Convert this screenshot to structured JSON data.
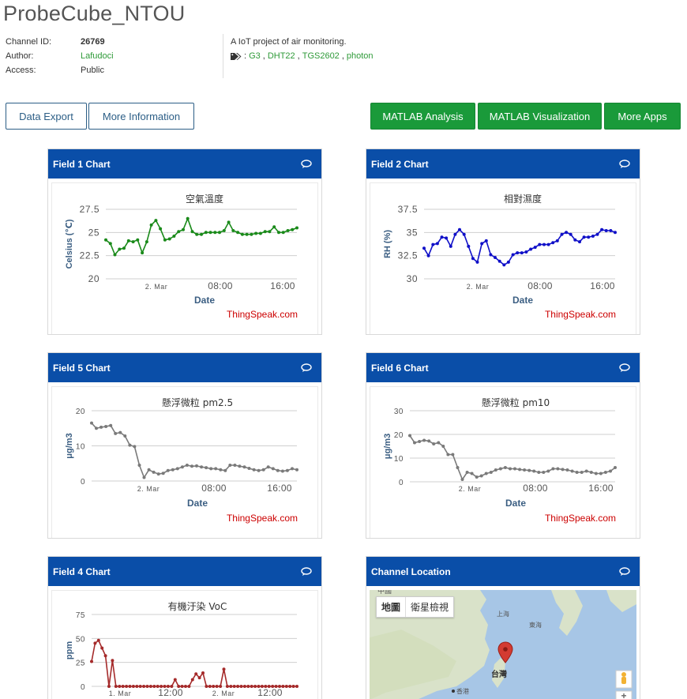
{
  "page": {
    "title": "ProbeCube_NTOU"
  },
  "channel": {
    "id_label": "Channel ID:",
    "id_value": "26769",
    "author_label": "Author:",
    "author_value": "Lafudoci",
    "access_label": "Access:",
    "access_value": "Public",
    "description": "A IoT project of air monitoring.",
    "tags": [
      "G3",
      "DHT22",
      "TGS2602",
      "photon"
    ]
  },
  "buttons": {
    "data_export": "Data Export",
    "more_information": "More Information",
    "matlab_analysis": "MATLAB Analysis",
    "matlab_visualization": "MATLAB Visualization",
    "more_apps": "More Apps"
  },
  "colors": {
    "header_blue": "#0a4ea8",
    "green_button": "#1a9a3a",
    "field1": "#1a8a1a",
    "field2": "#1010c8",
    "field5": "#7a7a7a",
    "field6": "#7a7a7a",
    "field4": "#a52a2a",
    "credit": "#cc0000"
  },
  "cards": {
    "field1": {
      "title": "Field 1 Chart",
      "credit": "ThingSpeak.com"
    },
    "field2": {
      "title": "Field 2 Chart",
      "credit": "ThingSpeak.com"
    },
    "field5": {
      "title": "Field 5 Chart",
      "credit": "ThingSpeak.com"
    },
    "field6": {
      "title": "Field 6 Chart",
      "credit": "ThingSpeak.com"
    },
    "field4": {
      "title": "Field 4 Chart"
    },
    "location": {
      "title": "Channel Location"
    }
  },
  "map": {
    "map_button": "地圖",
    "satellite_button": "衛星檢視",
    "labels": [
      "中國",
      "上海",
      "東海",
      "台灣",
      "香港"
    ],
    "marker": "location-pin-icon",
    "pegman": "pegman-icon",
    "zoom_in": "+"
  },
  "chart_data": [
    {
      "type": "line",
      "title": "空氣溫度",
      "xlabel": "Date",
      "ylabel": "Celsius (℃)",
      "ylim": [
        20,
        27.5
      ],
      "yticks": [
        "20",
        "22.5",
        "25",
        "27.5"
      ],
      "xticks": [
        "2. Mar",
        "08:00",
        "16:00"
      ],
      "series": [
        {
          "values": [
            24.2,
            23.8,
            22.6,
            23.2,
            23.3,
            24.1,
            24.0,
            24.2,
            22.8,
            24.0,
            25.8,
            26.3,
            25.4,
            24.2,
            24.3,
            24.6,
            25.1,
            25.3,
            26.5,
            25.1,
            24.8,
            24.8,
            25.0,
            25.0,
            25.0,
            25.0,
            25.2,
            26.1,
            25.2,
            25.0,
            24.8,
            24.8,
            24.8,
            24.9,
            24.9,
            25.1,
            25.1,
            25.6,
            25.0,
            25.0,
            25.2,
            25.3,
            25.5
          ]
        }
      ]
    },
    {
      "type": "line",
      "title": "相對濕度",
      "xlabel": "Date",
      "ylabel": "RH (%)",
      "ylim": [
        30,
        37.5
      ],
      "yticks": [
        "30",
        "32.5",
        "35",
        "37.5"
      ],
      "xticks": [
        "2. Mar",
        "08:00",
        "16:00"
      ],
      "series": [
        {
          "values": [
            33.3,
            32.5,
            33.7,
            33.8,
            34.5,
            34.4,
            33.5,
            34.8,
            35.3,
            34.8,
            33.5,
            32.2,
            31.8,
            33.8,
            34.1,
            32.6,
            32.3,
            31.9,
            31.5,
            31.8,
            32.6,
            32.8,
            32.8,
            32.9,
            33.2,
            33.4,
            33.7,
            33.7,
            33.7,
            33.9,
            34.1,
            34.8,
            35.0,
            34.8,
            34.2,
            34.0,
            34.5,
            34.5,
            34.6,
            34.8,
            35.3,
            35.2,
            35.2,
            35.0
          ]
        }
      ]
    },
    {
      "type": "line",
      "title": "懸浮微粒 pm2.5",
      "xlabel": "Date",
      "ylabel": "μg/m3",
      "ylim": [
        0,
        20
      ],
      "yticks": [
        "0",
        "10",
        "20"
      ],
      "xticks": [
        "2. Mar",
        "08:00",
        "16:00"
      ],
      "series": [
        {
          "values": [
            16.5,
            15.0,
            15.3,
            15.5,
            15.8,
            13.5,
            13.8,
            12.8,
            10.2,
            9.8,
            4.5,
            1.0,
            3.2,
            2.5,
            2.0,
            2.2,
            3.0,
            3.2,
            3.5,
            4.0,
            4.5,
            4.2,
            4.3,
            4.0,
            3.8,
            3.5,
            3.5,
            3.2,
            3.0,
            4.5,
            4.5,
            4.2,
            4.0,
            3.6,
            3.2,
            3.0,
            3.2,
            4.0,
            3.5,
            3.0,
            2.8,
            3.0,
            3.5,
            3.2
          ]
        }
      ]
    },
    {
      "type": "line",
      "title": "懸浮微粒 pm10",
      "xlabel": "Date",
      "ylabel": "μg/m3",
      "ylim": [
        0,
        30
      ],
      "yticks": [
        "0",
        "10",
        "20",
        "30"
      ],
      "xticks": [
        "2. Mar",
        "08:00",
        "16:00"
      ],
      "series": [
        {
          "values": [
            19.5,
            16.5,
            17.0,
            17.5,
            17.2,
            16.0,
            16.5,
            15.0,
            11.5,
            11.5,
            6.0,
            1.0,
            4.0,
            3.5,
            2.0,
            2.5,
            3.5,
            4.0,
            5.0,
            5.5,
            6.0,
            5.5,
            5.5,
            5.2,
            5.0,
            4.8,
            4.5,
            4.0,
            4.0,
            4.5,
            5.5,
            5.5,
            5.2,
            5.0,
            4.5,
            4.0,
            4.0,
            4.5,
            4.0,
            3.5,
            3.5,
            4.0,
            4.5,
            6.0
          ]
        }
      ]
    },
    {
      "type": "line",
      "title": "有機汙染 VoC",
      "xlabel": "",
      "ylabel": "ppm",
      "ylim": [
        0,
        75
      ],
      "yticks": [
        "0",
        "25",
        "50",
        "75"
      ],
      "xticks": [
        "1. Mar",
        "12:00",
        "2. Mar",
        "12:00"
      ],
      "series": [
        {
          "values": [
            26,
            45,
            48,
            40,
            32,
            0,
            27,
            0,
            0,
            0,
            0,
            0,
            0,
            0,
            0,
            0,
            0,
            0,
            0,
            0,
            0,
            0,
            0,
            0,
            7,
            0,
            0,
            0,
            0,
            7,
            13,
            9,
            14,
            0,
            0,
            0,
            0,
            0,
            18,
            0,
            0,
            0,
            0,
            0,
            0,
            0,
            0,
            0,
            0,
            0,
            0,
            0,
            0,
            0,
            0,
            0,
            0,
            0,
            0,
            0
          ]
        }
      ]
    }
  ]
}
